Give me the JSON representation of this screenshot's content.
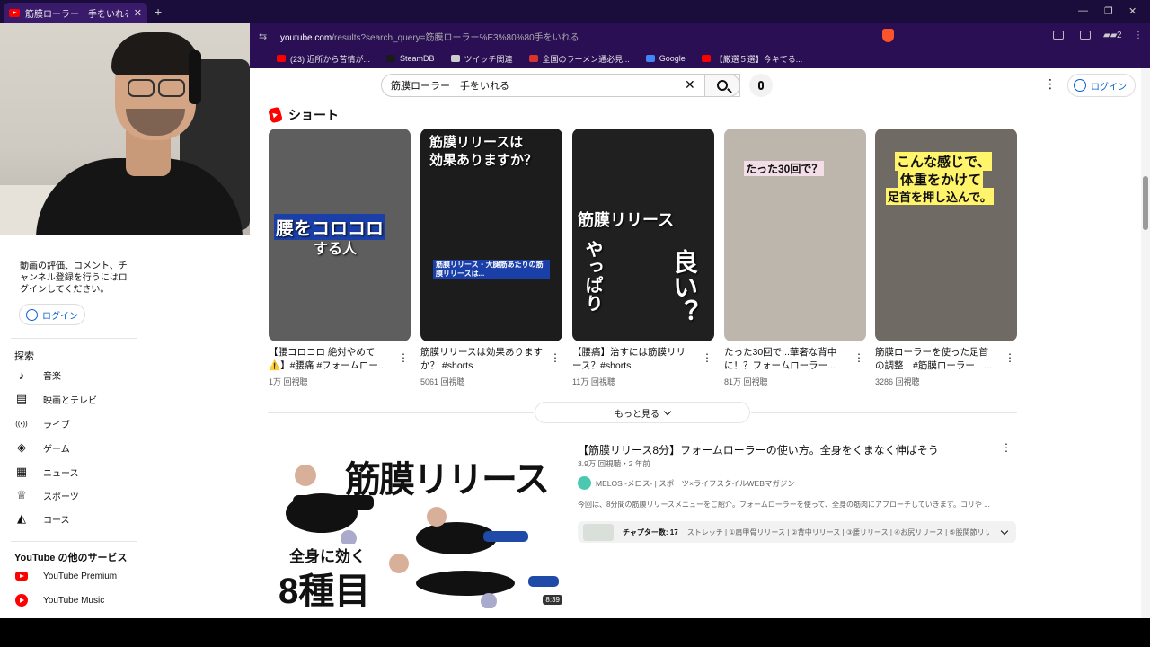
{
  "browser": {
    "tab_title": "筋膜ローラー　手をいれる - YouTube",
    "url_host": "youtube.com",
    "url_path": "/results?search_query=筋膜ローラー%E3%80%80手をいれる",
    "wallet_count": "2",
    "bookmarks": [
      {
        "label": "(23) 近所から苦情が...",
        "icon": "youtube",
        "color": "#ff0000"
      },
      {
        "label": "SteamDB",
        "icon": "steam",
        "color": "#1a1a1a"
      },
      {
        "label": "ツイッチ関連",
        "icon": "folder",
        "color": "#cccccc"
      },
      {
        "label": "全国のラーメン通必見...",
        "icon": "ramen",
        "color": "#d9342b"
      },
      {
        "label": "Google",
        "icon": "google",
        "color": "#4285f4"
      },
      {
        "label": "【厳選５選】今キてる...",
        "icon": "youtube",
        "color": "#ff0000"
      }
    ]
  },
  "header": {
    "search_value": "筋膜ローラー　手をいれる",
    "login_label": "ログイン"
  },
  "sidebar": {
    "signin_prompt": "動画の評価、コメント、チャンネル登録を行うにはログインしてください。",
    "login_label": "ログイン",
    "explore_heading": "探索",
    "items": [
      {
        "label": "音楽",
        "icon": "music-note-icon",
        "glyph": "♪"
      },
      {
        "label": "映画とテレビ",
        "icon": "film-icon",
        "glyph": "▤"
      },
      {
        "label": "ライブ",
        "icon": "live-icon",
        "glyph": "((•))"
      },
      {
        "label": "ゲーム",
        "icon": "gamepad-icon",
        "glyph": "◈"
      },
      {
        "label": "ニュース",
        "icon": "news-icon",
        "glyph": "▦"
      },
      {
        "label": "スポーツ",
        "icon": "trophy-icon",
        "glyph": "♕"
      },
      {
        "label": "コース",
        "icon": "graduation-cap-icon",
        "glyph": "◭"
      }
    ],
    "other_services_heading": "YouTube の他のサービス",
    "services": [
      {
        "label": "YouTube Premium",
        "icon": "youtube-premium-icon"
      },
      {
        "label": "YouTube Music",
        "icon": "youtube-music-icon"
      }
    ]
  },
  "shorts": {
    "heading": "ショート",
    "items": [
      {
        "title": "【腰コロコロ 絶対やめて⚠️】#腰痛 #フォームロー...",
        "views": "1万 回視聴",
        "caption_lines": [
          "腰をコロコロ",
          "する人"
        ],
        "bg": "#5e5e5e"
      },
      {
        "title": "筋膜リリースは効果ありますか？ #shorts",
        "views": "5061 回視聴",
        "caption_lines": [
          "筋膜リリースは",
          "効果ありますか？"
        ],
        "overlay": "筋膜リリース・大腿筋あたりの筋膜リリースは...",
        "bg": "#1c1c1c"
      },
      {
        "title": "【腰痛】治すには筋膜リリース？#shorts",
        "views": "11万 回視聴",
        "caption_lines": [
          "筋膜リリース",
          "やっぱり",
          "良い？"
        ],
        "bg": "#202020"
      },
      {
        "title": "たった30回で...華奢な背中に！？フォームローラー...",
        "views": "81万 回視聴",
        "caption_lines": [
          "たった30回で？"
        ],
        "bg": "#bdb6ad"
      },
      {
        "title": "筋膜ローラーを使った足首の調整　#筋膜ローラー　...",
        "views": "3286 回視聴",
        "caption_lines": [
          "こんな感じで、",
          "体重をかけて",
          "足首を押し込んで。"
        ],
        "bg": "#6f6b64"
      }
    ],
    "more_label": "もっと見る"
  },
  "video": {
    "title": "【筋膜リリース8分】フォームローラーの使い方。全身をくまなく伸ばそう",
    "meta": "3.9万 回視聴・2 年前",
    "channel": "MELOS -メロス- | スポーツ×ライフスタイルWEBマガジン",
    "description": "今回は、8分間の筋膜リリースメニューをご紹介。フォームローラーを使って、全身の筋肉にアプローチしていきます。コリや ...",
    "duration": "8:39",
    "thumb_caption_main": "筋膜リリース",
    "thumb_caption_sub": "全身に効く",
    "thumb_caption_big": "8種目",
    "chapters_label": "チャプター数: 17",
    "chapters_list": "ストレッチ | ①肩甲骨リリース | ②背中リリース | ③腰リリース | ④お尻リリース | ⑤股関節リリ..."
  }
}
